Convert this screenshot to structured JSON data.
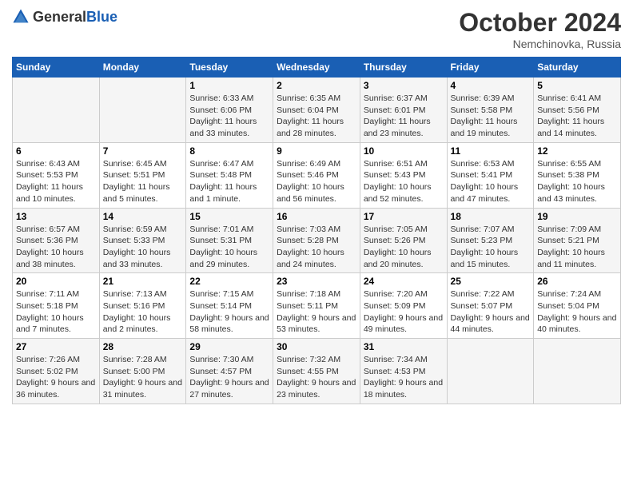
{
  "header": {
    "logo_general": "General",
    "logo_blue": "Blue",
    "month_title": "October 2024",
    "location": "Nemchinovka, Russia"
  },
  "weekdays": [
    "Sunday",
    "Monday",
    "Tuesday",
    "Wednesday",
    "Thursday",
    "Friday",
    "Saturday"
  ],
  "weeks": [
    [
      {
        "day": "",
        "info": ""
      },
      {
        "day": "",
        "info": ""
      },
      {
        "day": "1",
        "info": "Sunrise: 6:33 AM\nSunset: 6:06 PM\nDaylight: 11 hours and 33 minutes."
      },
      {
        "day": "2",
        "info": "Sunrise: 6:35 AM\nSunset: 6:04 PM\nDaylight: 11 hours and 28 minutes."
      },
      {
        "day": "3",
        "info": "Sunrise: 6:37 AM\nSunset: 6:01 PM\nDaylight: 11 hours and 23 minutes."
      },
      {
        "day": "4",
        "info": "Sunrise: 6:39 AM\nSunset: 5:58 PM\nDaylight: 11 hours and 19 minutes."
      },
      {
        "day": "5",
        "info": "Sunrise: 6:41 AM\nSunset: 5:56 PM\nDaylight: 11 hours and 14 minutes."
      }
    ],
    [
      {
        "day": "6",
        "info": "Sunrise: 6:43 AM\nSunset: 5:53 PM\nDaylight: 11 hours and 10 minutes."
      },
      {
        "day": "7",
        "info": "Sunrise: 6:45 AM\nSunset: 5:51 PM\nDaylight: 11 hours and 5 minutes."
      },
      {
        "day": "8",
        "info": "Sunrise: 6:47 AM\nSunset: 5:48 PM\nDaylight: 11 hours and 1 minute."
      },
      {
        "day": "9",
        "info": "Sunrise: 6:49 AM\nSunset: 5:46 PM\nDaylight: 10 hours and 56 minutes."
      },
      {
        "day": "10",
        "info": "Sunrise: 6:51 AM\nSunset: 5:43 PM\nDaylight: 10 hours and 52 minutes."
      },
      {
        "day": "11",
        "info": "Sunrise: 6:53 AM\nSunset: 5:41 PM\nDaylight: 10 hours and 47 minutes."
      },
      {
        "day": "12",
        "info": "Sunrise: 6:55 AM\nSunset: 5:38 PM\nDaylight: 10 hours and 43 minutes."
      }
    ],
    [
      {
        "day": "13",
        "info": "Sunrise: 6:57 AM\nSunset: 5:36 PM\nDaylight: 10 hours and 38 minutes."
      },
      {
        "day": "14",
        "info": "Sunrise: 6:59 AM\nSunset: 5:33 PM\nDaylight: 10 hours and 33 minutes."
      },
      {
        "day": "15",
        "info": "Sunrise: 7:01 AM\nSunset: 5:31 PM\nDaylight: 10 hours and 29 minutes."
      },
      {
        "day": "16",
        "info": "Sunrise: 7:03 AM\nSunset: 5:28 PM\nDaylight: 10 hours and 24 minutes."
      },
      {
        "day": "17",
        "info": "Sunrise: 7:05 AM\nSunset: 5:26 PM\nDaylight: 10 hours and 20 minutes."
      },
      {
        "day": "18",
        "info": "Sunrise: 7:07 AM\nSunset: 5:23 PM\nDaylight: 10 hours and 15 minutes."
      },
      {
        "day": "19",
        "info": "Sunrise: 7:09 AM\nSunset: 5:21 PM\nDaylight: 10 hours and 11 minutes."
      }
    ],
    [
      {
        "day": "20",
        "info": "Sunrise: 7:11 AM\nSunset: 5:18 PM\nDaylight: 10 hours and 7 minutes."
      },
      {
        "day": "21",
        "info": "Sunrise: 7:13 AM\nSunset: 5:16 PM\nDaylight: 10 hours and 2 minutes."
      },
      {
        "day": "22",
        "info": "Sunrise: 7:15 AM\nSunset: 5:14 PM\nDaylight: 9 hours and 58 minutes."
      },
      {
        "day": "23",
        "info": "Sunrise: 7:18 AM\nSunset: 5:11 PM\nDaylight: 9 hours and 53 minutes."
      },
      {
        "day": "24",
        "info": "Sunrise: 7:20 AM\nSunset: 5:09 PM\nDaylight: 9 hours and 49 minutes."
      },
      {
        "day": "25",
        "info": "Sunrise: 7:22 AM\nSunset: 5:07 PM\nDaylight: 9 hours and 44 minutes."
      },
      {
        "day": "26",
        "info": "Sunrise: 7:24 AM\nSunset: 5:04 PM\nDaylight: 9 hours and 40 minutes."
      }
    ],
    [
      {
        "day": "27",
        "info": "Sunrise: 7:26 AM\nSunset: 5:02 PM\nDaylight: 9 hours and 36 minutes."
      },
      {
        "day": "28",
        "info": "Sunrise: 7:28 AM\nSunset: 5:00 PM\nDaylight: 9 hours and 31 minutes."
      },
      {
        "day": "29",
        "info": "Sunrise: 7:30 AM\nSunset: 4:57 PM\nDaylight: 9 hours and 27 minutes."
      },
      {
        "day": "30",
        "info": "Sunrise: 7:32 AM\nSunset: 4:55 PM\nDaylight: 9 hours and 23 minutes."
      },
      {
        "day": "31",
        "info": "Sunrise: 7:34 AM\nSunset: 4:53 PM\nDaylight: 9 hours and 18 minutes."
      },
      {
        "day": "",
        "info": ""
      },
      {
        "day": "",
        "info": ""
      }
    ]
  ]
}
